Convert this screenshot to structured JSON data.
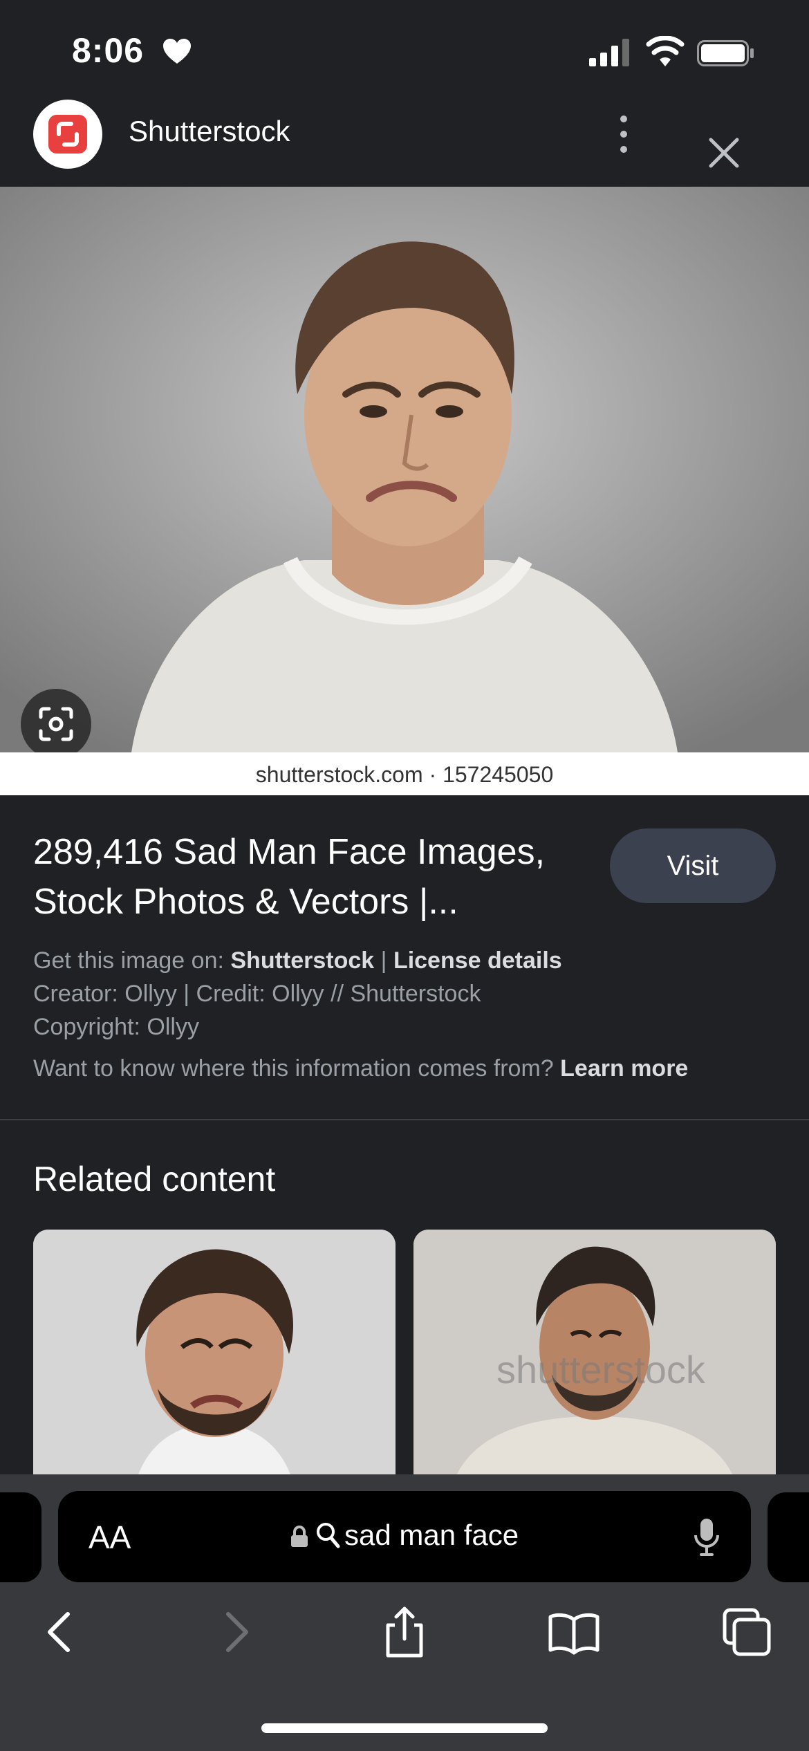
{
  "status": {
    "time": "8:06"
  },
  "header": {
    "site_name": "Shutterstock"
  },
  "image": {
    "caption": "shutterstock.com · 157245050"
  },
  "result": {
    "title": "289,416 Sad Man Face Images, Stock Photos & Vectors |...",
    "visit_label": "Visit",
    "get_image_prefix": "Get this image on: ",
    "get_image_source": "Shutterstock",
    "separator": " | ",
    "license_label": "License details",
    "creator_line": "Creator: Ollyy | Credit: Ollyy // Shutterstock",
    "copyright_line": "Copyright: Ollyy",
    "info_question": "Want to know where this information comes from? ",
    "learn_more": "Learn more"
  },
  "related": {
    "title": "Related content",
    "cards": [
      {
        "watermark": ""
      },
      {
        "watermark": "shutterstock"
      }
    ]
  },
  "browser": {
    "text_size_label": "AA",
    "query": "sad man face"
  },
  "icons": [
    "heart-icon",
    "cellular-signal-icon",
    "wifi-icon",
    "battery-icon",
    "shutterstock-logo",
    "more-vert-icon",
    "close-icon",
    "lens-icon",
    "lock-icon",
    "search-icon",
    "microphone-icon",
    "back-icon",
    "forward-icon",
    "share-icon",
    "bookmarks-icon",
    "tabs-icon"
  ]
}
